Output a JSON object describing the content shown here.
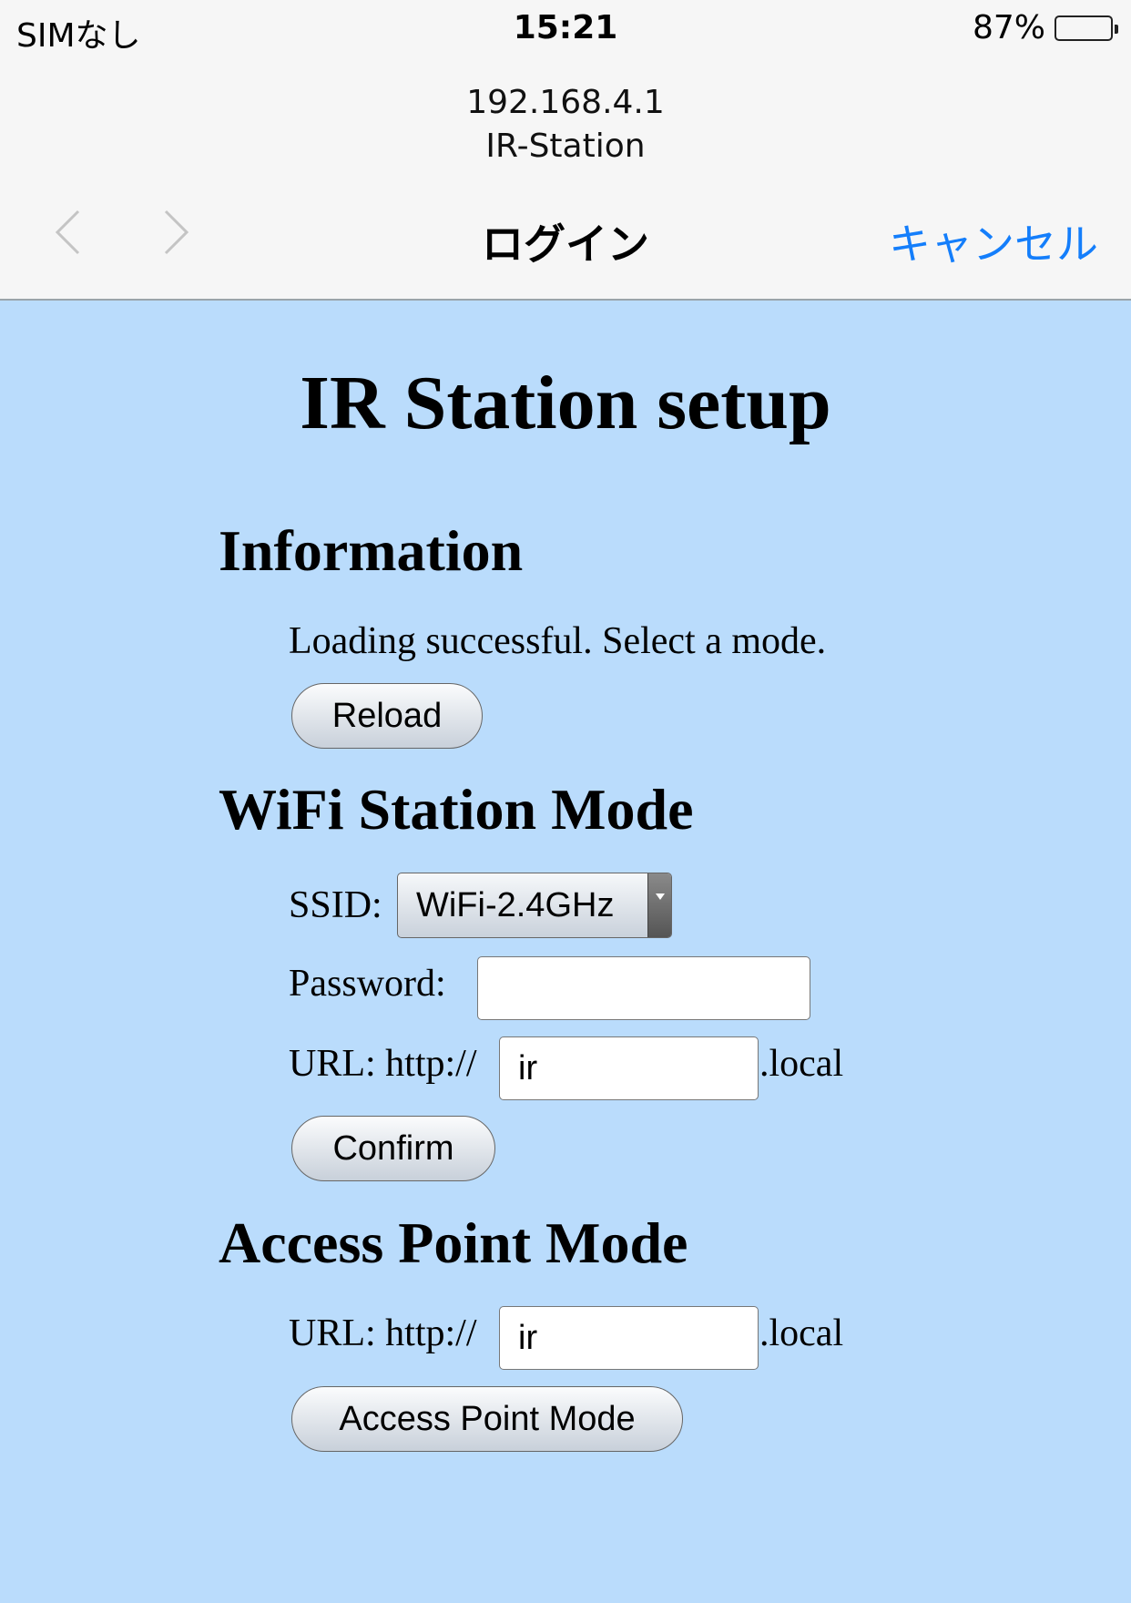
{
  "status_bar": {
    "carrier": "SIMなし",
    "time": "15:21",
    "battery_percent_label": "87%",
    "battery_level": 0.87
  },
  "browser": {
    "host": "192.168.4.1",
    "page_name": "IR-Station",
    "title": "ログイン",
    "cancel_label": "キャンセル",
    "back_icon": "chevron-left-icon",
    "forward_icon": "chevron-right-icon",
    "accent_color": "#147efb"
  },
  "page": {
    "title": "IR Station setup",
    "background_color": "#badcfc",
    "information": {
      "heading": "Information",
      "message": "Loading successful. Select a mode.",
      "reload_label": "Reload"
    },
    "wifi_station": {
      "heading": "WiFi Station Mode",
      "ssid_label": "SSID:",
      "ssid_selected": "WiFi-2.4GHz",
      "password_label": "Password:",
      "password_value": "",
      "url_prefix": "URL: http://",
      "url_value": "ir",
      "url_suffix": ".local",
      "confirm_label": "Confirm"
    },
    "access_point": {
      "heading": "Access Point Mode",
      "url_prefix": "URL: http://",
      "url_value": "ir",
      "url_suffix": ".local",
      "button_label": "Access Point Mode"
    }
  }
}
